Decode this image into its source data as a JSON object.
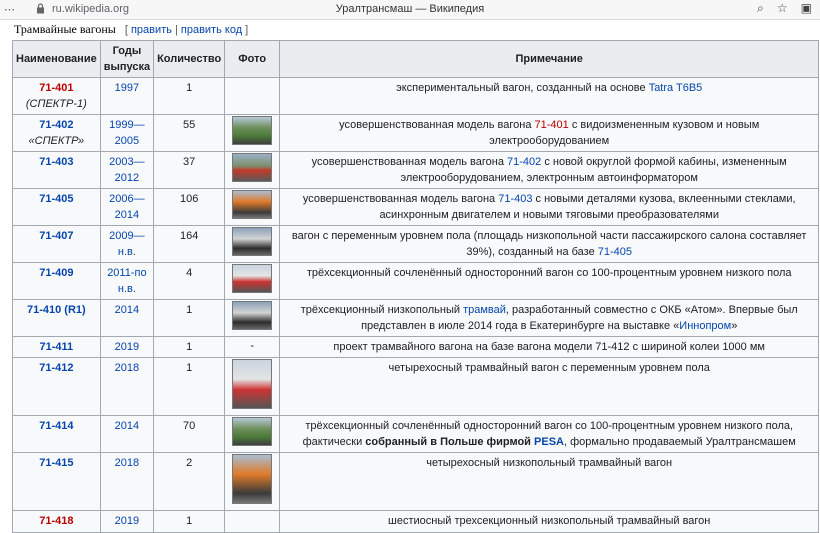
{
  "browser": {
    "url": "ru.wikipedia.org",
    "title": "Уралтрансмаш — Википедия"
  },
  "section": {
    "title": "Трамвайные вагоны",
    "edit_open": "[ ",
    "edit": "править",
    "sep": " | ",
    "edit_code": "править код",
    "edit_close": " ]"
  },
  "table": {
    "headers": {
      "name": "Наименование",
      "years": "Годы выпуска",
      "qty": "Количество",
      "photo": "Фото",
      "note": "Примечание"
    },
    "rows": [
      {
        "name": "71-401",
        "name_color": "red",
        "sub": "(СПЕКТР-1)",
        "years": "1997",
        "qty": "1",
        "photo": "",
        "note": [
          {
            "t": "экспериментальный вагон, созданный на основе "
          },
          {
            "t": "Tatra T6B5",
            "l": "blue"
          }
        ]
      },
      {
        "name": "71-402",
        "name_color": "blue",
        "sub": "«СПЕКТР»",
        "years": "1999—2005",
        "qty": "55",
        "photo": "tram",
        "note": [
          {
            "t": "усовершенствованная модель вагона "
          },
          {
            "t": "71-401",
            "l": "red"
          },
          {
            "t": " с видоизмененным кузовом и новым электрооборудованием"
          }
        ]
      },
      {
        "name": "71-403",
        "name_color": "blue",
        "sub": "",
        "years": "2003—2012",
        "qty": "37",
        "photo": "tram",
        "note": [
          {
            "t": "усовершенствованная модель вагона "
          },
          {
            "t": "71-402",
            "l": "blue"
          },
          {
            "t": " с новой округлой формой кабины, измененным электрооборудованием, электронным автоинформатором"
          }
        ]
      },
      {
        "name": "71-405",
        "name_color": "blue",
        "sub": "",
        "years": "2006—2014",
        "qty": "106",
        "photo": "tram",
        "note": [
          {
            "t": "усовершенствованная модель вагона "
          },
          {
            "t": "71-403",
            "l": "blue"
          },
          {
            "t": " с новыми деталями кузова, вклеенными стеклами, асинхронным двигателем и новыми тяговыми преобразователями"
          }
        ]
      },
      {
        "name": "71-407",
        "name_color": "blue",
        "sub": "",
        "years": "2009—н.в.",
        "qty": "164",
        "photo": "tram",
        "note": [
          {
            "t": "вагон с переменным уровнем пола (площадь низкопольной части пассажирского салона составляет 39%), созданный на базе "
          },
          {
            "t": "71-405",
            "l": "blue"
          }
        ]
      },
      {
        "name": "71-409",
        "name_color": "blue",
        "sub": "",
        "years": "2011-по н.в.",
        "qty": "4",
        "photo": "tram",
        "note": [
          {
            "t": "трёхсекционный сочленённый односторонний вагон со 100-процентным уровнем низкого пола"
          }
        ]
      },
      {
        "name": "71-410 (R1)",
        "name_color": "blue",
        "sub": "",
        "years": "2014",
        "qty": "1",
        "photo": "tram",
        "note": [
          {
            "t": "трёхсекционный низкопольный "
          },
          {
            "t": "трамвай",
            "l": "blue"
          },
          {
            "t": ", разработанный совместно с ОКБ «Атом». Впервые был представлен в июле 2014 года в Екатеринбурге на выставке «"
          },
          {
            "t": "Иннопром",
            "l": "blue"
          },
          {
            "t": "»"
          }
        ]
      },
      {
        "name": "71-411",
        "name_color": "blue",
        "sub": "",
        "years": "2019",
        "qty": "1",
        "photo": "-",
        "note": [
          {
            "t": "проект трамвайного вагона на базе вагона модели 71-412 с шириной колеи 1000 мм"
          }
        ]
      },
      {
        "name": "71-412",
        "name_color": "blue",
        "sub": "",
        "years": "2018",
        "qty": "1",
        "photo": "tall",
        "note": [
          {
            "t": "четырехосный трамвайный вагон с переменным уровнем пола"
          }
        ]
      },
      {
        "name": "71-414",
        "name_color": "blue",
        "sub": "",
        "years": "2014",
        "qty": "70",
        "photo": "tram",
        "note": [
          {
            "t": "трёхсекционный сочленённый односторонний вагон со 100-процентным уровнем низкого пола, фактически "
          },
          {
            "t": "собранный в Польше фирмой ",
            "b": true
          },
          {
            "t": "PESA",
            "l": "blue",
            "b": true
          },
          {
            "t": ", формально продаваемый Уралтрансмашем"
          }
        ]
      },
      {
        "name": "71-415",
        "name_color": "blue",
        "sub": "",
        "years": "2018",
        "qty": "2",
        "photo": "tall",
        "note": [
          {
            "t": "четырехосный низкопольный трамвайный вагон"
          }
        ]
      },
      {
        "name": "71-418",
        "name_color": "red",
        "sub": "",
        "years": "2019",
        "qty": "1",
        "photo": "",
        "note": [
          {
            "t": "шестиосный трехсекционный низкопольный трамвайный вагон"
          }
        ]
      }
    ]
  }
}
